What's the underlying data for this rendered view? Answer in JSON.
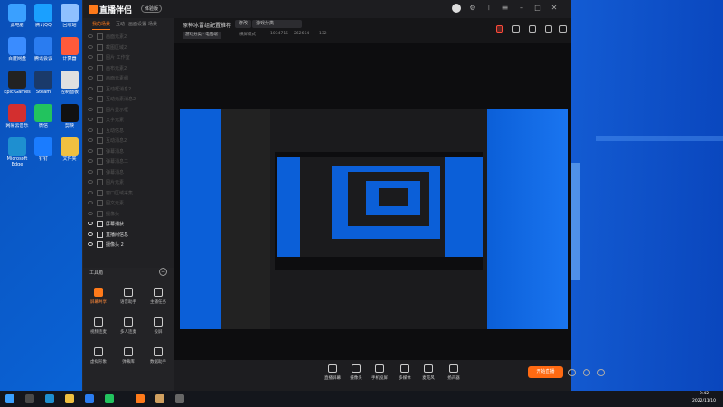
{
  "app": {
    "name": "直播伴侣",
    "badge": "体验版",
    "sidebar_tabs": [
      "我的场景",
      "互动",
      "画面设置",
      "场景"
    ],
    "scenes": [
      {
        "label": "画面元素2",
        "active": false
      },
      {
        "label": "截图区域2",
        "active": false
      },
      {
        "label": "图片 工作室",
        "active": false
      },
      {
        "label": "画布元素2",
        "active": false
      },
      {
        "label": "画面元素组",
        "active": false
      },
      {
        "label": "互动框消息2",
        "active": false
      },
      {
        "label": "互动元素消息2",
        "active": false
      },
      {
        "label": "图片显示框",
        "active": false
      },
      {
        "label": "文字元素",
        "active": false
      },
      {
        "label": "互动信息",
        "active": false
      },
      {
        "label": "互动消息2",
        "active": false
      },
      {
        "label": "弹幕消息",
        "active": false
      },
      {
        "label": "弹幕消息二",
        "active": false
      },
      {
        "label": "弹幕消息",
        "active": false
      },
      {
        "label": "图片元素",
        "active": false
      },
      {
        "label": "窗口区域采集",
        "active": false
      },
      {
        "label": "图文元素",
        "active": false
      },
      {
        "label": "摄像头",
        "active": false
      },
      {
        "label": "屏幕捕获",
        "active": true
      },
      {
        "label": "直播间信息",
        "active": true
      },
      {
        "label": "摄像头 2",
        "active": true
      }
    ],
    "toolbox": {
      "title": "工具箱",
      "tools": [
        {
          "label": "屏幕共享",
          "hot": true
        },
        {
          "label": "语音助手",
          "hot": false
        },
        {
          "label": "主播任务",
          "hot": false
        },
        {
          "label": "视频连麦",
          "hot": false
        },
        {
          "label": "多人连麦",
          "hot": false
        },
        {
          "label": "投屏",
          "hot": false
        },
        {
          "label": "虚拟形象",
          "hot": false
        },
        {
          "label": "弹幕库",
          "hot": false
        },
        {
          "label": "数据助手",
          "hot": false
        }
      ]
    },
    "header": {
      "room_title": "原神冰雷组配置推荐",
      "edit_pill": "修改",
      "category_pill": "游戏分类",
      "meta_tag": "游戏分类 · 电脑端",
      "meta_mode": "横屏模式",
      "meta_id": "1034715",
      "meta_likes": "262664",
      "meta_fans": "132"
    },
    "bottom_tools": [
      "直播屏幕",
      "摄像头",
      "手机投屏",
      "多媒体",
      "麦克风",
      "扬声器"
    ],
    "start_button": "开始直播"
  },
  "taskbar": {
    "time": "9:42",
    "date": "2022/11/10"
  },
  "desktop_icons": [
    {
      "label": "此电脑",
      "color": "#3aa0ff"
    },
    {
      "label": "腾讯QQ",
      "color": "#1aa0ff"
    },
    {
      "label": "回收站",
      "color": "#8fc0ff"
    },
    {
      "label": "百度网盘",
      "color": "#3a8cff"
    },
    {
      "label": "腾讯会议",
      "color": "#2a7cf0"
    },
    {
      "label": "计算器",
      "color": "#ff5a3a"
    },
    {
      "label": "Epic Games",
      "color": "#222"
    },
    {
      "label": "Steam",
      "color": "#1a3a6a"
    },
    {
      "label": "控制面板",
      "color": "#e0e0e0"
    },
    {
      "label": "网易云音乐",
      "color": "#d32f2f"
    },
    {
      "label": "微信",
      "color": "#22c35e"
    },
    {
      "label": "剪映",
      "color": "#111"
    },
    {
      "label": "Microsoft Edge",
      "color": "#1e8fd0"
    },
    {
      "label": "钉钉",
      "color": "#1a7cff"
    },
    {
      "label": "文件夹",
      "color": "#f0c040"
    }
  ]
}
